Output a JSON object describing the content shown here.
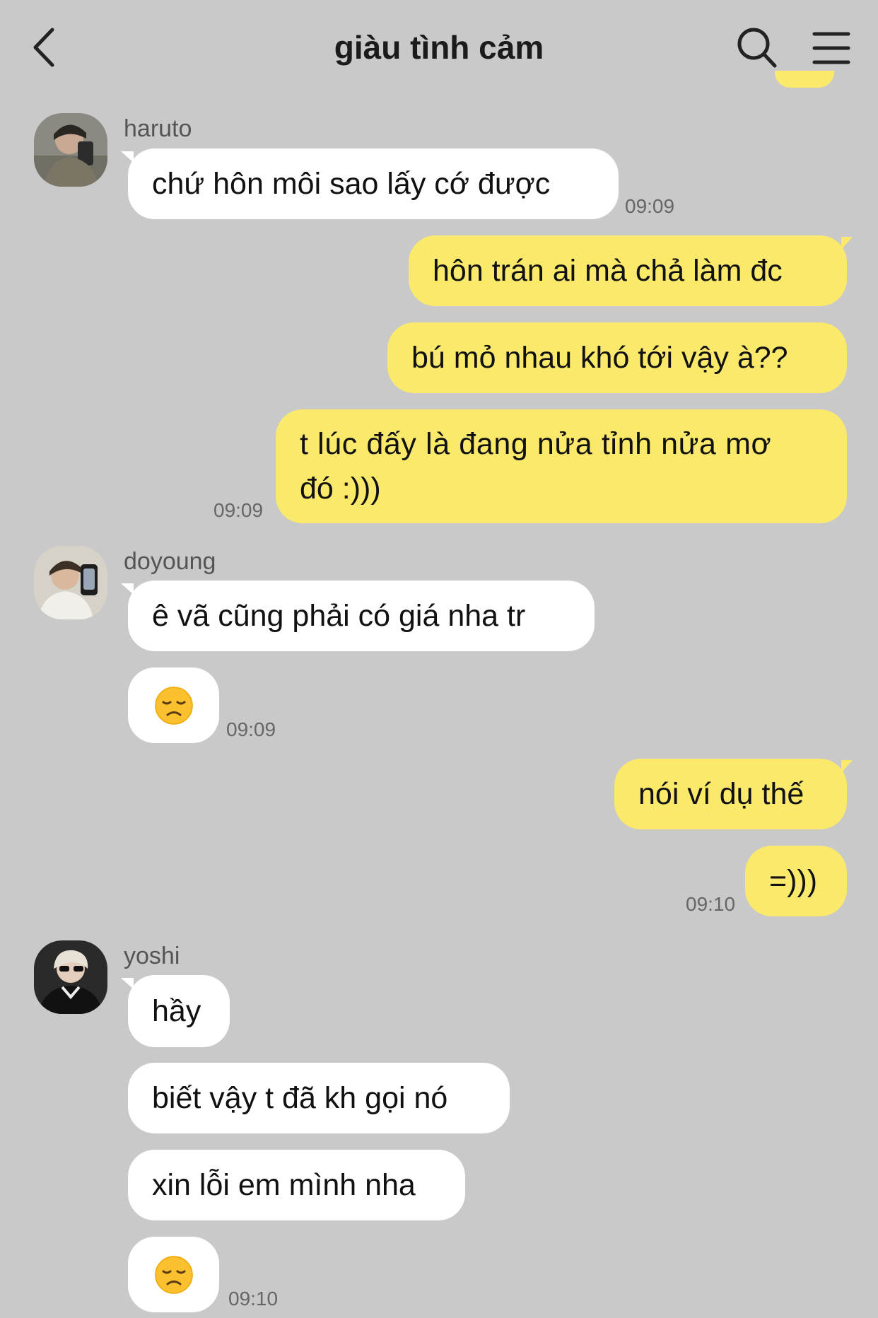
{
  "colors": {
    "background": "#c9c9c9",
    "incoming_bubble": "#ffffff",
    "outgoing_bubble": "#fbe96b"
  },
  "header": {
    "title": "giàu tình cảm",
    "back_icon": "chevron-left-icon",
    "search_icon": "search-icon",
    "menu_icon": "hamburger-menu-icon"
  },
  "messages": [
    {
      "sender": "haruto",
      "text": "chứ hôn môi sao lấy cớ được",
      "time": "09:09"
    },
    {
      "text": "hôn trán ai mà chả làm đc"
    },
    {
      "text": "bú mỏ nhau khó tới vậy à??"
    },
    {
      "line1": "t lúc đấy là đang nửa tỉnh nửa mơ",
      "line2": "đó :)))",
      "time": "09:09"
    },
    {
      "sender": "doyoung",
      "text": "ê vã cũng phải có giá nha tr"
    },
    {
      "text": "😞",
      "time": "09:09"
    },
    {
      "text": "nói ví dụ thế"
    },
    {
      "text": "=)))",
      "time": "09:10"
    },
    {
      "sender": "yoshi",
      "text": "hầy"
    },
    {
      "text": "biết vậy t đã kh gọi nó"
    },
    {
      "text": "xin lỗi em mình nha"
    },
    {
      "text": "😞",
      "time": "09:10"
    }
  ]
}
